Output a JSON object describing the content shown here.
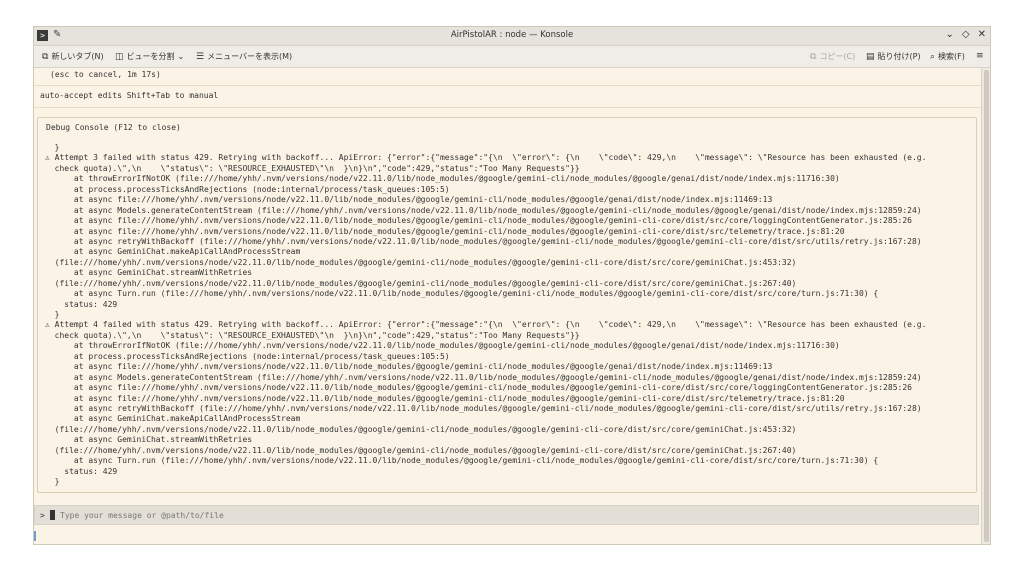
{
  "window": {
    "title": "AirPistolAR : node — Konsole",
    "app_icon_glyph": ">",
    "pin_glyph": "✎",
    "controls": [
      "⌄",
      "◇",
      "✕"
    ]
  },
  "toolbar": {
    "new_tab": "新しいタブ(N)",
    "split_view": "ビューを分割",
    "show_menubar": "メニューバーを表示(M)",
    "copy": "コピー(C)",
    "paste": "貼り付け(P)",
    "find": "検索(F)",
    "menu_glyph": "≡"
  },
  "terminal": {
    "cancel_line": "(esc to cancel, 1m 17s)",
    "auto_accept": "auto-accept edits Shift+Tab to manual",
    "debug_title": "Debug Console (F12 to close)",
    "debug_lines": [
      "  }",
      "⚠ Attempt 3 failed with status 429. Retrying with backoff... ApiError: {\"error\":{\"message\":\"{\\n  \\\"error\\\": {\\n    \\\"code\\\": 429,\\n    \\\"message\\\": \\\"Resource has been exhausted (e.g.",
      "  check quota).\\\",\\n    \\\"status\\\": \\\"RESOURCE_EXHAUSTED\\\"\\n  }\\n}\\n\",\"code\":429,\"status\":\"Too Many Requests\"}}",
      "      at throwErrorIfNotOK (file:///home/yhh/.nvm/versions/node/v22.11.0/lib/node_modules/@google/gemini-cli/node_modules/@google/genai/dist/node/index.mjs:11716:30)",
      "      at process.processTicksAndRejections (node:internal/process/task_queues:105:5)",
      "      at async file:///home/yhh/.nvm/versions/node/v22.11.0/lib/node_modules/@google/gemini-cli/node_modules/@google/genai/dist/node/index.mjs:11469:13",
      "      at async Models.generateContentStream (file:///home/yhh/.nvm/versions/node/v22.11.0/lib/node_modules/@google/gemini-cli/node_modules/@google/genai/dist/node/index.mjs:12859:24)",
      "      at async file:///home/yhh/.nvm/versions/node/v22.11.0/lib/node_modules/@google/gemini-cli/node_modules/@google/gemini-cli-core/dist/src/core/loggingContentGenerator.js:285:26",
      "      at async file:///home/yhh/.nvm/versions/node/v22.11.0/lib/node_modules/@google/gemini-cli/node_modules/@google/gemini-cli-core/dist/src/telemetry/trace.js:81:20",
      "      at async retryWithBackoff (file:///home/yhh/.nvm/versions/node/v22.11.0/lib/node_modules/@google/gemini-cli/node_modules/@google/gemini-cli-core/dist/src/utils/retry.js:167:28)",
      "      at async GeminiChat.makeApiCallAndProcessStream",
      "  (file:///home/yhh/.nvm/versions/node/v22.11.0/lib/node_modules/@google/gemini-cli/node_modules/@google/gemini-cli-core/dist/src/core/geminiChat.js:453:32)",
      "      at async GeminiChat.streamWithRetries",
      "  (file:///home/yhh/.nvm/versions/node/v22.11.0/lib/node_modules/@google/gemini-cli/node_modules/@google/gemini-cli-core/dist/src/core/geminiChat.js:267:40)",
      "      at async Turn.run (file:///home/yhh/.nvm/versions/node/v22.11.0/lib/node_modules/@google/gemini-cli/node_modules/@google/gemini-cli-core/dist/src/core/turn.js:71:30) {",
      "    status: 429",
      "  }",
      "⚠ Attempt 4 failed with status 429. Retrying with backoff... ApiError: {\"error\":{\"message\":\"{\\n  \\\"error\\\": {\\n    \\\"code\\\": 429,\\n    \\\"message\\\": \\\"Resource has been exhausted (e.g.",
      "  check quota).\\\",\\n    \\\"status\\\": \\\"RESOURCE_EXHAUSTED\\\"\\n  }\\n}\\n\",\"code\":429,\"status\":\"Too Many Requests\"}}",
      "      at throwErrorIfNotOK (file:///home/yhh/.nvm/versions/node/v22.11.0/lib/node_modules/@google/gemini-cli/node_modules/@google/genai/dist/node/index.mjs:11716:30)",
      "      at process.processTicksAndRejections (node:internal/process/task_queues:105:5)",
      "      at async file:///home/yhh/.nvm/versions/node/v22.11.0/lib/node_modules/@google/gemini-cli/node_modules/@google/genai/dist/node/index.mjs:11469:13",
      "      at async Models.generateContentStream (file:///home/yhh/.nvm/versions/node/v22.11.0/lib/node_modules/@google/gemini-cli/node_modules/@google/genai/dist/node/index.mjs:12859:24)",
      "      at async file:///home/yhh/.nvm/versions/node/v22.11.0/lib/node_modules/@google/gemini-cli/node_modules/@google/gemini-cli-core/dist/src/core/loggingContentGenerator.js:285:26",
      "      at async file:///home/yhh/.nvm/versions/node/v22.11.0/lib/node_modules/@google/gemini-cli/node_modules/@google/gemini-cli-core/dist/src/telemetry/trace.js:81:20",
      "      at async retryWithBackoff (file:///home/yhh/.nvm/versions/node/v22.11.0/lib/node_modules/@google/gemini-cli/node_modules/@google/gemini-cli-core/dist/src/utils/retry.js:167:28)",
      "      at async GeminiChat.makeApiCallAndProcessStream",
      "  (file:///home/yhh/.nvm/versions/node/v22.11.0/lib/node_modules/@google/gemini-cli/node_modules/@google/gemini-cli-core/dist/src/core/geminiChat.js:453:32)",
      "      at async GeminiChat.streamWithRetries",
      "  (file:///home/yhh/.nvm/versions/node/v22.11.0/lib/node_modules/@google/gemini-cli/node_modules/@google/gemini-cli-core/dist/src/core/geminiChat.js:267:40)",
      "      at async Turn.run (file:///home/yhh/.nvm/versions/node/v22.11.0/lib/node_modules/@google/gemini-cli/node_modules/@google/gemini-cli-core/dist/src/core/turn.js:71:30) {",
      "    status: 429",
      "  }"
    ],
    "prompt_symbol": ">",
    "input_placeholder": "Type your message or @path/to/file"
  }
}
